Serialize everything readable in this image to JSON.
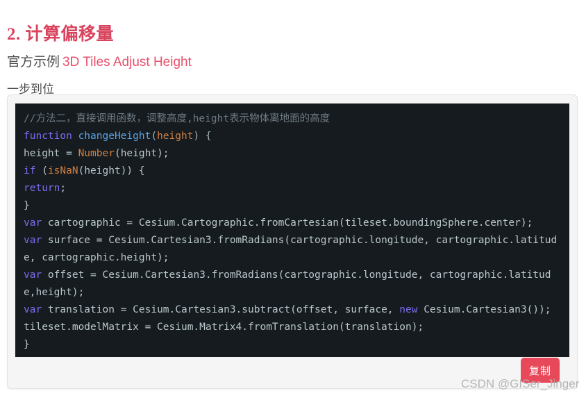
{
  "article": {
    "heading": "2. 计算偏移量",
    "intro_prefix": "官方示例",
    "intro_link": "3D Tiles Adjust Height",
    "note": "一步到位"
  },
  "code_block": {
    "language": "javascript",
    "copy_label": "复制",
    "background_color": "#161b1f",
    "tokens": {
      "comment_color": "#6e7b84",
      "keyword_color": "#7d6cf0",
      "function_color": "#5ba4e5",
      "builtin_color": "#cf8043",
      "text_color": "#b9c7cd"
    },
    "lines": [
      {
        "tokens": [
          {
            "t": "//方法二，直接调用函数，调整高度,height表示物体离地面的高度",
            "c": "c-comment"
          }
        ]
      },
      {
        "tokens": [
          {
            "t": "function",
            "c": "c-keyword"
          },
          {
            "t": " ",
            "c": "c-plain"
          },
          {
            "t": "changeHeight",
            "c": "c-func"
          },
          {
            "t": "(",
            "c": "c-punct"
          },
          {
            "t": "height",
            "c": "c-param"
          },
          {
            "t": ") {",
            "c": "c-punct"
          }
        ]
      },
      {
        "tokens": [
          {
            "t": "height = ",
            "c": "c-plain"
          },
          {
            "t": "Number",
            "c": "c-builtin"
          },
          {
            "t": "(height);",
            "c": "c-plain"
          }
        ]
      },
      {
        "tokens": [
          {
            "t": "if",
            "c": "c-keyword"
          },
          {
            "t": " (",
            "c": "c-plain"
          },
          {
            "t": "isNaN",
            "c": "c-builtin"
          },
          {
            "t": "(height)) {",
            "c": "c-plain"
          }
        ]
      },
      {
        "tokens": [
          {
            "t": "return",
            "c": "c-keyword"
          },
          {
            "t": ";",
            "c": "c-plain"
          }
        ]
      },
      {
        "tokens": [
          {
            "t": "}",
            "c": "c-plain"
          }
        ]
      },
      {
        "tokens": [
          {
            "t": "var",
            "c": "c-keyword"
          },
          {
            "t": " cartographic = Cesium.Cartographic.fromCartesian(tileset.boundingSphere.center);",
            "c": "c-plain"
          }
        ]
      },
      {
        "tokens": [
          {
            "t": "var",
            "c": "c-keyword"
          },
          {
            "t": " surface = Cesium.Cartesian3.fromRadians(cartographic.longitude, cartographic.latitude, cartographic.height);",
            "c": "c-plain"
          }
        ]
      },
      {
        "tokens": [
          {
            "t": "var",
            "c": "c-keyword"
          },
          {
            "t": " offset = Cesium.Cartesian3.fromRadians(cartographic.longitude, cartographic.latitude,height);",
            "c": "c-plain"
          }
        ]
      },
      {
        "tokens": [
          {
            "t": "var",
            "c": "c-keyword"
          },
          {
            "t": " translation = Cesium.Cartesian3.subtract(offset, surface, ",
            "c": "c-plain"
          },
          {
            "t": "new",
            "c": "c-keyword"
          },
          {
            "t": " Cesium.Cartesian3());",
            "c": "c-plain"
          }
        ]
      },
      {
        "tokens": [
          {
            "t": "tileset.modelMatrix = Cesium.Matrix4.fromTranslation(translation);",
            "c": "c-plain"
          }
        ]
      },
      {
        "tokens": [
          {
            "t": "}",
            "c": "c-plain"
          }
        ]
      }
    ]
  },
  "watermark": {
    "text": "CSDN @GISer_Jinger"
  }
}
